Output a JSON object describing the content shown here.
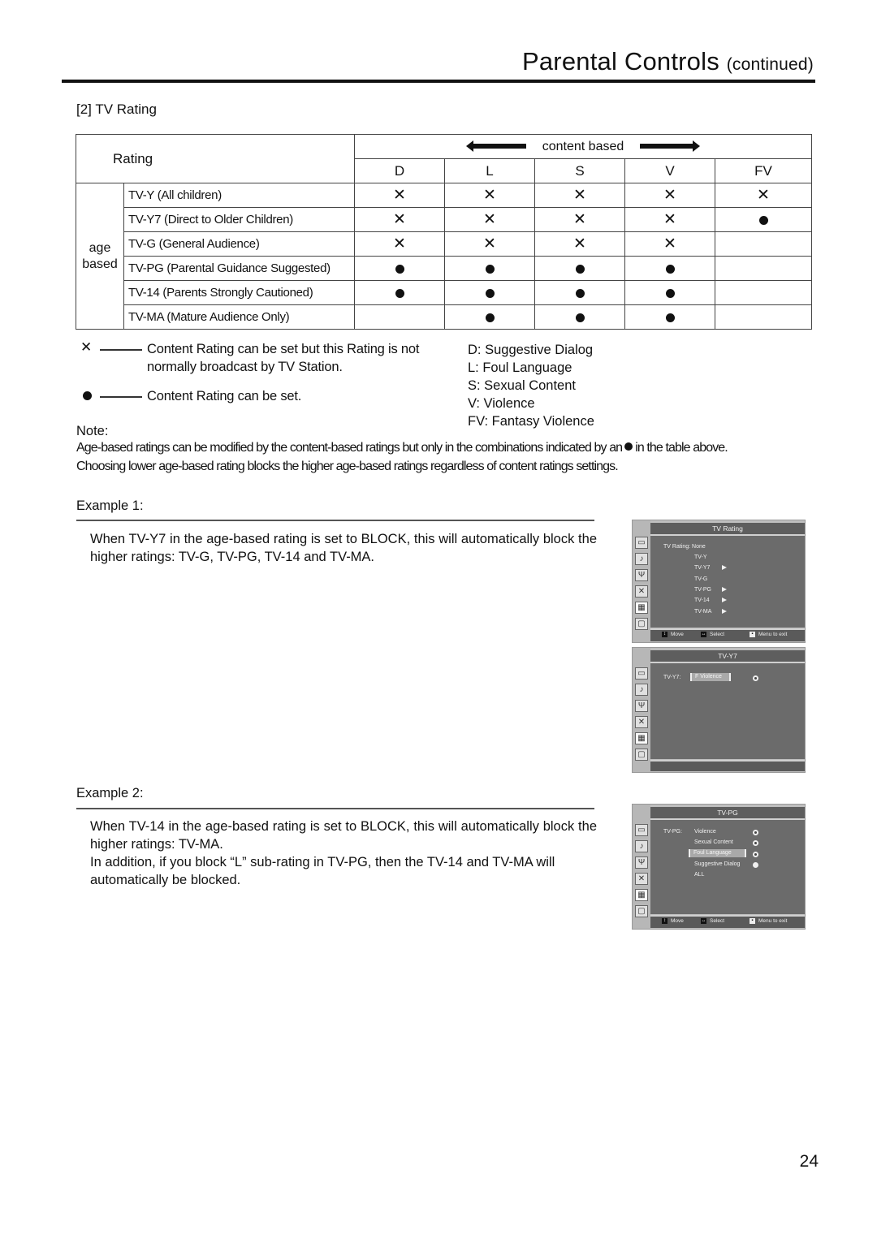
{
  "header": {
    "title": "Parental Controls",
    "title_suffix": "(continued)"
  },
  "section": {
    "title": "[2] TV Rating"
  },
  "rating_table": {
    "rating_header": "Rating",
    "content_header": "content based",
    "age_label_line1": "age",
    "age_label_line2": "based",
    "columns": [
      "D",
      "L",
      "S",
      "V",
      "FV"
    ],
    "rows": [
      {
        "label": "TV-Y (All children)",
        "marks": [
          "x",
          "x",
          "x",
          "x",
          "x"
        ]
      },
      {
        "label": "TV-Y7 (Direct to Older Children)",
        "marks": [
          "x",
          "x",
          "x",
          "x",
          "dot"
        ]
      },
      {
        "label": "TV-G (General Audience)",
        "marks": [
          "x",
          "x",
          "x",
          "x",
          ""
        ]
      },
      {
        "label": "TV-PG (Parental Guidance Suggested)",
        "marks": [
          "dot",
          "dot",
          "dot",
          "dot",
          ""
        ]
      },
      {
        "label": "TV-14 (Parents Strongly Cautioned)",
        "marks": [
          "dot",
          "dot",
          "dot",
          "dot",
          ""
        ]
      },
      {
        "label": "TV-MA (Mature Audience Only)",
        "marks": [
          "",
          "dot",
          "dot",
          "dot",
          ""
        ]
      }
    ],
    "symbols": {
      "x": "✕",
      "dot": "●"
    }
  },
  "legend": {
    "x_symbol": "✕",
    "x_text_line1": "Content Rating can be set but this Rating is not",
    "x_text_line2": "normally broadcast by TV Station.",
    "dot_text": "Content Rating can be set."
  },
  "abbreviations": [
    "D: Suggestive Dialog",
    "L: Foul  Language",
    "S: Sexual Content",
    "V: Violence",
    "FV: Fantasy Violence"
  ],
  "note": {
    "label": "Note:",
    "line1_pre": "Age-based ratings can be modified by the content-based ratings but only in the combinations indicated by an",
    "line1_post": "in the table above.",
    "line2": "Choosing lower age-based rating blocks the higher age-based ratings regardless of content ratings settings."
  },
  "example1": {
    "title": "Example 1:",
    "body": "When TV-Y7 in the age-based rating is set to BLOCK, this will automatically block the higher ratings: TV-G, TV-PG, TV-14 and TV-MA."
  },
  "example2": {
    "title": "Example 2:",
    "body1": "When TV-14 in the age-based rating is set to BLOCK, this will automatically block the higher ratings: TV-MA.",
    "body2": "In addition, if you block “L” sub-rating in TV-PG, then the TV-14 and TV-MA will automatically be blocked."
  },
  "osd1": {
    "title": "TV Rating",
    "status_label": "TV Rating: None",
    "items": [
      {
        "label": "TV-Y",
        "submenu": false
      },
      {
        "label": "TV-Y7",
        "submenu": true
      },
      {
        "label": "TV-G",
        "submenu": false
      },
      {
        "label": "TV-PG",
        "submenu": true
      },
      {
        "label": "TV-14",
        "submenu": true
      },
      {
        "label": "TV-MA",
        "submenu": true
      }
    ],
    "footer": {
      "move": "Move",
      "select": "Select",
      "exit": "Menu to exit"
    }
  },
  "osd2": {
    "title": "TV-Y7",
    "row_label": "TV-Y7:",
    "selected_item": "F Violence"
  },
  "osd3": {
    "title": "TV-PG",
    "row_label": "TV-PG:",
    "items": [
      {
        "label": "Violence",
        "state": "ring"
      },
      {
        "label": "Sexual Content",
        "state": "ring"
      },
      {
        "label": "Foul Language",
        "state": "ring",
        "highlighted": true
      },
      {
        "label": "Suggestive Dialog",
        "state": "filled"
      },
      {
        "label": "ALL",
        "state": "none"
      }
    ],
    "footer": {
      "move": "Move",
      "select": "Select",
      "exit": "Menu to exit"
    }
  },
  "page_number": "24"
}
